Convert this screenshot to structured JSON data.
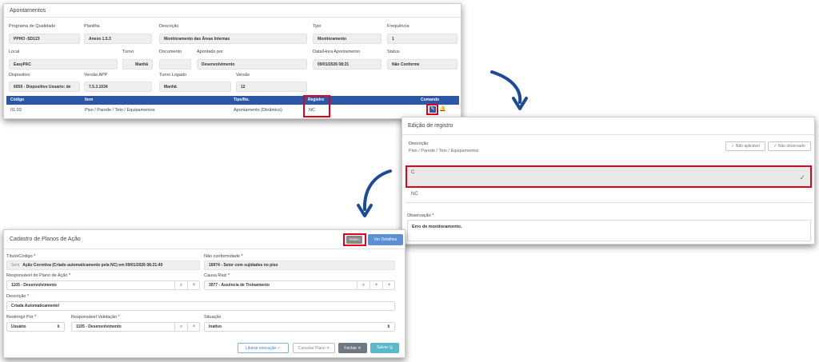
{
  "apontamentos": {
    "title": "Apontamentos",
    "fields": {
      "programa": {
        "label": "Programa de Qualidade",
        "value": "PPHO -SD123"
      },
      "planilha": {
        "label": "Planilha",
        "value": "Anexo 1.5.3"
      },
      "descricao": {
        "label": "Descrição",
        "value": "Monitoramento das Áreas Internas"
      },
      "tipo": {
        "label": "Tipo",
        "value": "Monitoramento"
      },
      "frequencia": {
        "label": "Frequência",
        "value": "1"
      },
      "local": {
        "label": "Local",
        "value": "EasyPAC"
      },
      "turno": {
        "label": "Turno",
        "value": "Manhã"
      },
      "documento": {
        "label": "Documento",
        "value": ""
      },
      "apontado_por": {
        "label": "Apontado por",
        "value": "Desenvolvimento"
      },
      "data_hora": {
        "label": "Data/Hora Apontamento",
        "value": "09/01/2026 08:21"
      },
      "status": {
        "label": "Status",
        "value": "Não Conforme"
      },
      "dispositivo": {
        "label": "Dispositivo",
        "value": "6059 - Dispositivo Usuario: de"
      },
      "versao_app": {
        "label": "Versão APP",
        "value": "7.5.3.1034"
      },
      "turno_logado": {
        "label": "Turno Logado",
        "value": "Manhã"
      },
      "versao": {
        "label": "Versão",
        "value": "12"
      }
    },
    "table": {
      "headers": [
        "Código",
        "Item",
        "Tipo/No.",
        "Registro",
        "Comando"
      ],
      "row": [
        "01.03",
        "Piso / Parede / Teto / Equipamentos",
        "Apontamento (Dinâmico)",
        "NC"
      ]
    }
  },
  "edicao": {
    "title": "Edição de registro",
    "descricao_label": "Descrição",
    "descricao_value": "Piso / Parede / Teto / Equipamentos",
    "btn_nao_aplicavel": "✓ Não aplicável",
    "btn_nao_observado": "✓ Não observado",
    "option_c": "C",
    "option_nc": "NC",
    "observacao_label": "Observação",
    "observacao_value": "Erro de monitoramento."
  },
  "cadastro": {
    "title": "Cadastro de Planos de Ação",
    "badge": "Inativo",
    "ver_detalhes": "Ver Detalhes",
    "titulo_label": "Título/Código",
    "titulo_prefix": "Sem",
    "titulo_value": "Ação Corretiva (Criado automaticamente pela NC) em 09/01/2026 08:21:40",
    "nao_conformidade_label": "Não conformidade",
    "nao_conformidade_value": "16974 - Setor com sujidades no piso",
    "responsavel_label": "Responsável do Plano de Ação",
    "responsavel_value": "1105 - Desenvolvimento",
    "causa_label": "Causa Raiz",
    "causa_value": "3077 - Ausência de Treinamento",
    "descricao_label": "Descrição",
    "descricao_value": "Criada Automaticamente!",
    "restringir_label": "Restringir Por",
    "restringir_value": "Usuário",
    "resp_validacao_label": "Responsável Validação",
    "resp_validacao_value": "1105 - Desenvolvimento",
    "situacao_label": "Situação",
    "situacao_value": "Inativo",
    "btn_liberar": "Liberar execução ✓",
    "btn_cancelar": "Cancelar Plano ✕",
    "btn_fechar": "Fechar ✕",
    "btn_salvar": "Salvar 🖫"
  },
  "colors": {
    "accent": "#2c56a6",
    "highlight": "#e2001a",
    "arrow": "#1d4a96",
    "success": "#2eaa4f",
    "button_blue": "#5b8fd6",
    "button_teal": "#5ab9c9",
    "button_gray": "#6f7780"
  },
  "icons": [
    "check-icon",
    "search-icon",
    "close-icon",
    "edit-icon",
    "chevron-updown-icon",
    "curved-arrow-icon"
  ]
}
